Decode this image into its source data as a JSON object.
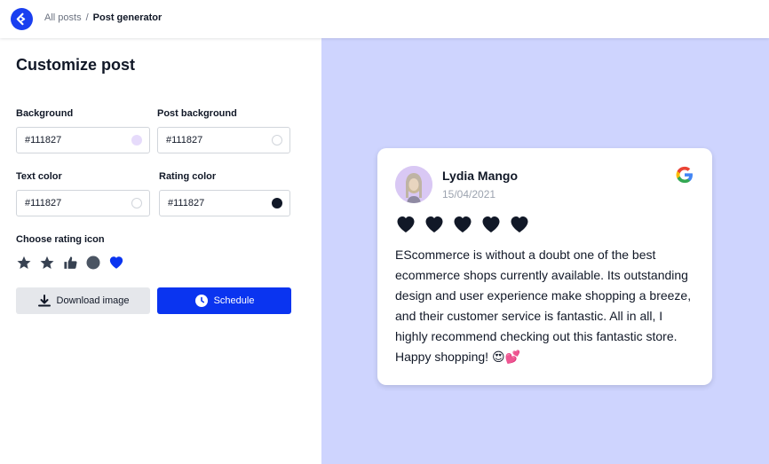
{
  "breadcrumb": {
    "parent": "All posts",
    "separator": "/",
    "current": "Post generator"
  },
  "panel": {
    "title": "Customize post",
    "fields": [
      {
        "label": "Background",
        "value": "#111827",
        "swatch": "#e6dbfb"
      },
      {
        "label": "Post background",
        "value": "#111827",
        "swatch": "#ffffff"
      },
      {
        "label": "Text color",
        "value": "#111827",
        "swatch": "#ffffff"
      },
      {
        "label": "Rating color",
        "value": "#111827",
        "swatch": "#111827"
      }
    ],
    "rating_icons_label": "Choose rating icon",
    "rating_icons": [
      "star-outline-icon",
      "star-icon",
      "thumbs-up-icon",
      "circle-icon",
      "heart-icon"
    ],
    "selected_rating_icon": "heart-icon",
    "download_label": "Download image",
    "schedule_label": "Schedule"
  },
  "review": {
    "name": "Lydia Mango",
    "date": "15/04/2021",
    "rating": 5,
    "text": "EScommerce is without a doubt one of the best ecommerce shops currently available. Its outstanding design and user experience make shopping a breeze, and their customer service is fantastic. All in all, I highly recommend checking out this fantastic store. Happy shopping! 😍💕",
    "source_icon": "google-icon"
  },
  "colors": {
    "accent": "#0a34f0",
    "preview_bg": "#ced4fe",
    "text": "#111827",
    "rating": "#111827"
  }
}
